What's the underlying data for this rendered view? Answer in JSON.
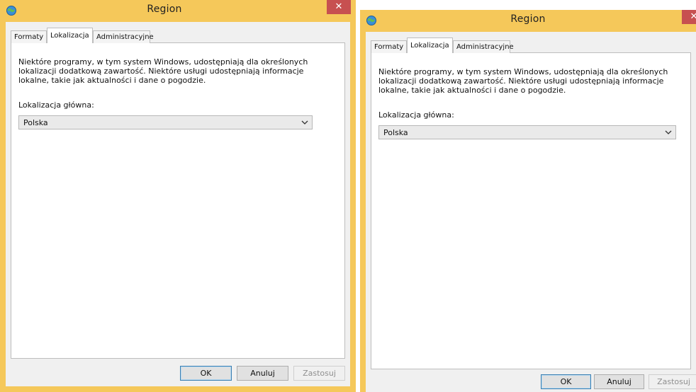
{
  "windows": [
    {
      "title": "Region",
      "close_glyph": "✕",
      "tabs": [
        "Formaty",
        "Lokalizacja",
        "Administracyjne"
      ],
      "active_tab": "Lokalizacja",
      "description": "Niektóre programy, w tym system Windows, udostępniają dla określonych lokalizacji dodatkową zawartość. Niektóre usługi udostępniają informacje lokalne, takie jak aktualności i dane o pogodzie.",
      "location_label": "Lokalizacja główna:",
      "location_value": "Polska",
      "buttons": {
        "ok": "OK",
        "cancel": "Anuluj",
        "apply": "Zastosuj"
      }
    },
    {
      "title": "Region",
      "close_glyph": "✕",
      "tabs": [
        "Formaty",
        "Lokalizacja",
        "Administracyjne"
      ],
      "active_tab": "Lokalizacja",
      "description": "Niektóre programy, w tym system Windows, udostępniają dla określonych lokalizacji dodatkową zawartość. Niektóre usługi udostępniają informacje lokalne, takie jak aktualności i dane o pogodzie.",
      "location_label": "Lokalizacja główna:",
      "location_value": "Polska",
      "buttons": {
        "ok": "OK",
        "cancel": "Anuluj",
        "apply": "Zastosuj"
      }
    }
  ],
  "icons": {
    "app": "region-globe-icon",
    "close": "close-icon",
    "dropdown": "chevron-down-icon"
  },
  "colors": {
    "frame": "#f5c85a",
    "close": "#c75050",
    "client": "#f0f0f0",
    "panel": "#ffffff"
  }
}
